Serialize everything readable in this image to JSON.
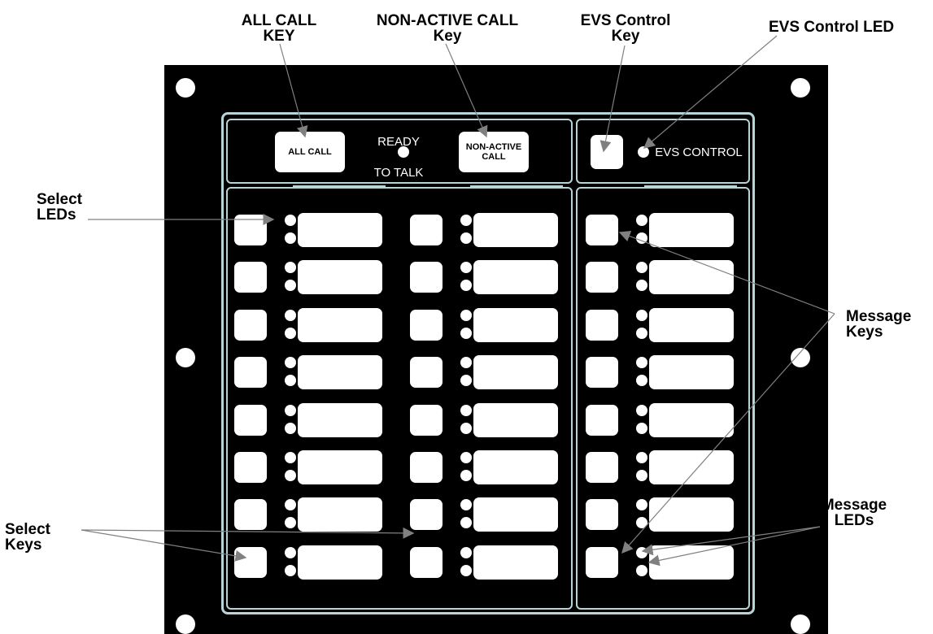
{
  "callouts": {
    "all_call_key": "ALL CALL\nKEY",
    "non_active_call_key": "NON-ACTIVE CALL\nKey",
    "evs_control_key": "EVS Control\nKey",
    "evs_control_led": "EVS Control LED",
    "select_leds": "Select\nLEDs",
    "message_keys": "Message\nKeys",
    "select_keys": "Select\nKeys",
    "message_leds": "Message\nLEDs"
  },
  "panel": {
    "all_call_button": "ALL CALL",
    "ready_to_talk": "READY\nTO TALK",
    "non_active_call_button": "NON-ACTIVE\nCALL",
    "evs_control": "EVS CONTROL"
  },
  "grid": {
    "select_rows_per_column": 8,
    "select_columns": 2,
    "message_rows": 8
  }
}
